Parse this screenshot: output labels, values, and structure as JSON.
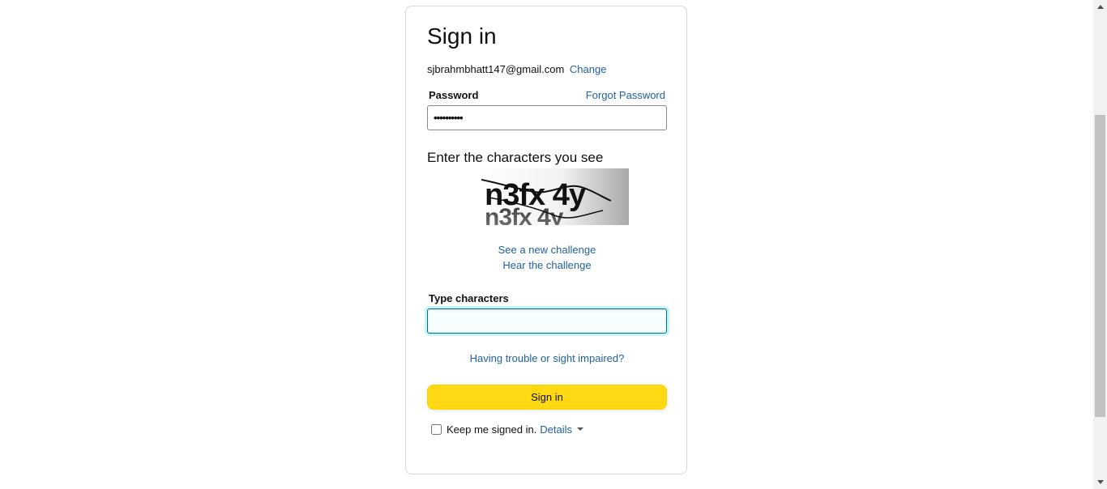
{
  "signin": {
    "title": "Sign in",
    "email": "sjbrahmbhatt147@gmail.com",
    "change_link": "Change",
    "password_label": "Password",
    "forgot_link": "Forgot Password",
    "password_value": "••••••••••",
    "captcha_heading": "Enter the characters you see",
    "captcha_text": "n3fx 4y",
    "new_challenge_link": "See a new challenge",
    "hear_challenge_link": "Hear the challenge",
    "type_label": "Type characters",
    "type_value": "",
    "trouble_link": "Having trouble or sight impaired?",
    "signin_button": "Sign in",
    "keep_signed_in": "Keep me signed in.",
    "keep_signed_in_checked": false,
    "details_link": "Details"
  },
  "colors": {
    "link": "#2162a1",
    "button": "#ffd814",
    "focus": "#007185"
  }
}
